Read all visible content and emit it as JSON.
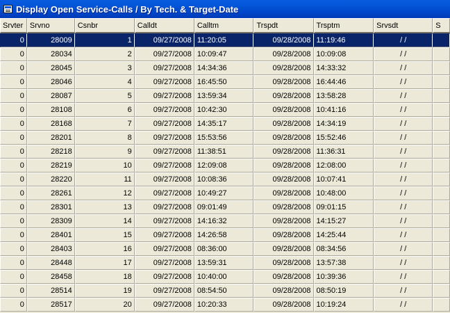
{
  "window": {
    "title": "Display Open Service-Calls / By Tech. & Target-Date"
  },
  "grid": {
    "columns": [
      {
        "key": "srvter",
        "label": "Srvter"
      },
      {
        "key": "srvno",
        "label": "Srvno"
      },
      {
        "key": "csnbr",
        "label": "Csnbr"
      },
      {
        "key": "calldt",
        "label": "Calldt"
      },
      {
        "key": "calltm",
        "label": "Calltm"
      },
      {
        "key": "trspdt",
        "label": "Trspdt"
      },
      {
        "key": "trsptm",
        "label": "Trsptm"
      },
      {
        "key": "srvsdt",
        "label": "Srvsdt"
      },
      {
        "key": "s",
        "label": "S"
      }
    ],
    "selected_row": 0,
    "rows": [
      [
        "0",
        "28009",
        "1",
        "09/27/2008",
        "11:20:05",
        "09/28/2008",
        "11:19:46",
        " / /",
        ""
      ],
      [
        "0",
        "28034",
        "2",
        "09/27/2008",
        "10:09:47",
        "09/28/2008",
        "10:09:08",
        " / /",
        ""
      ],
      [
        "0",
        "28045",
        "3",
        "09/27/2008",
        "14:34:36",
        "09/28/2008",
        "14:33:32",
        " / /",
        ""
      ],
      [
        "0",
        "28046",
        "4",
        "09/27/2008",
        "16:45:50",
        "09/28/2008",
        "16:44:46",
        " / /",
        ""
      ],
      [
        "0",
        "28087",
        "5",
        "09/27/2008",
        "13:59:34",
        "09/28/2008",
        "13:58:28",
        " / /",
        ""
      ],
      [
        "0",
        "28108",
        "6",
        "09/27/2008",
        "10:42:30",
        "09/28/2008",
        "10:41:16",
        " / /",
        ""
      ],
      [
        "0",
        "28168",
        "7",
        "09/27/2008",
        "14:35:17",
        "09/28/2008",
        "14:34:19",
        " / /",
        ""
      ],
      [
        "0",
        "28201",
        "8",
        "09/27/2008",
        "15:53:56",
        "09/28/2008",
        "15:52:46",
        " / /",
        ""
      ],
      [
        "0",
        "28218",
        "9",
        "09/27/2008",
        "11:38:51",
        "09/28/2008",
        "11:36:31",
        " / /",
        ""
      ],
      [
        "0",
        "28219",
        "10",
        "09/27/2008",
        "12:09:08",
        "09/28/2008",
        "12:08:00",
        " / /",
        ""
      ],
      [
        "0",
        "28220",
        "11",
        "09/27/2008",
        "10:08:36",
        "09/28/2008",
        "10:07:41",
        " / /",
        ""
      ],
      [
        "0",
        "28261",
        "12",
        "09/27/2008",
        "10:49:27",
        "09/28/2008",
        "10:48:00",
        " / /",
        ""
      ],
      [
        "0",
        "28301",
        "13",
        "09/27/2008",
        "09:01:49",
        "09/28/2008",
        "09:01:15",
        " / /",
        ""
      ],
      [
        "0",
        "28309",
        "14",
        "09/27/2008",
        "14:16:32",
        "09/28/2008",
        "14:15:27",
        " / /",
        ""
      ],
      [
        "0",
        "28401",
        "15",
        "09/27/2008",
        "14:26:58",
        "09/28/2008",
        "14:25:44",
        " / /",
        ""
      ],
      [
        "0",
        "28403",
        "16",
        "09/27/2008",
        "08:36:00",
        "09/28/2008",
        "08:34:56",
        " / /",
        ""
      ],
      [
        "0",
        "28448",
        "17",
        "09/27/2008",
        "13:59:31",
        "09/28/2008",
        "13:57:38",
        " / /",
        ""
      ],
      [
        "0",
        "28458",
        "18",
        "09/27/2008",
        "10:40:00",
        "09/28/2008",
        "10:39:36",
        " / /",
        ""
      ],
      [
        "0",
        "28514",
        "19",
        "09/27/2008",
        "08:54:50",
        "09/28/2008",
        "08:50:19",
        " / /",
        ""
      ],
      [
        "0",
        "28517",
        "20",
        "09/27/2008",
        "10:20:33",
        "09/28/2008",
        "10:19:24",
        " / /",
        ""
      ]
    ]
  },
  "colors": {
    "titlebar": "#0a5adf",
    "selection": "#0a246a",
    "face": "#ece9d8"
  },
  "icons": {
    "title": "window-icon"
  }
}
